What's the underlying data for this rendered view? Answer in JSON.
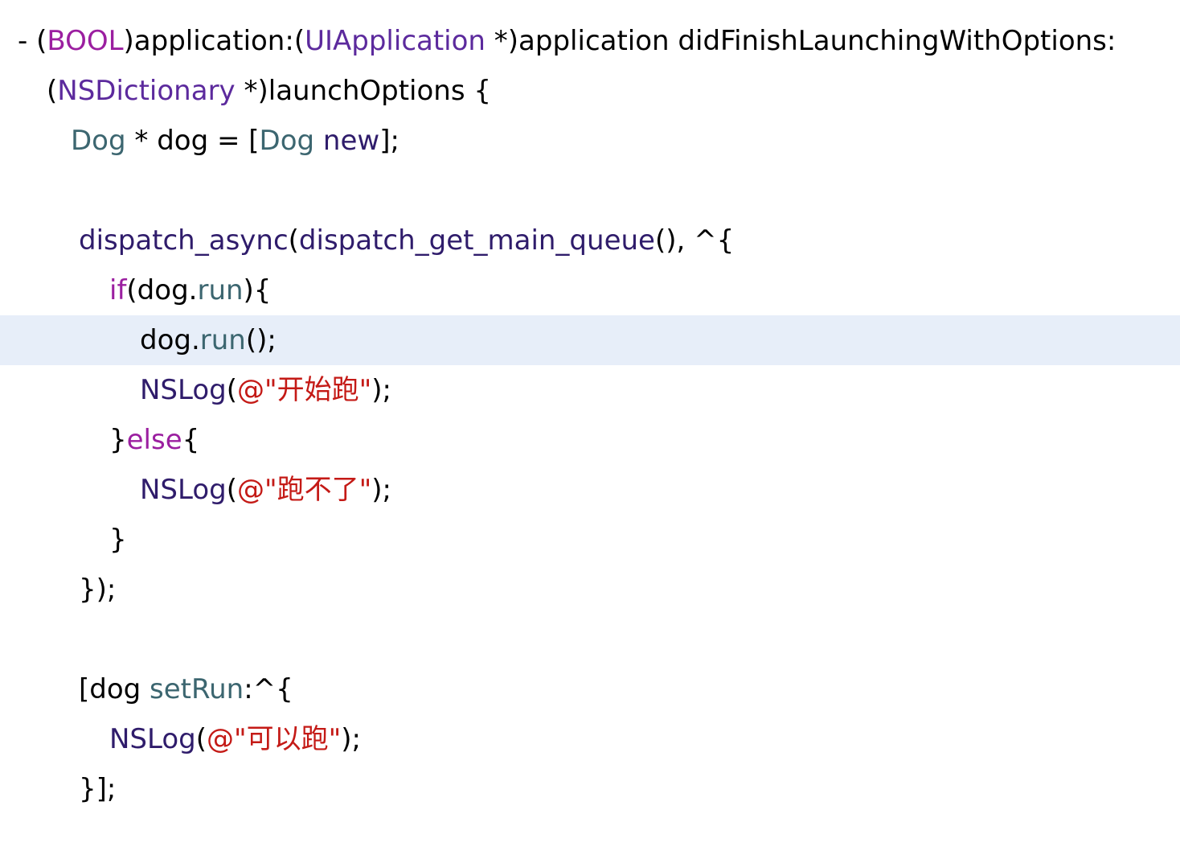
{
  "editor": {
    "language": "objective-c",
    "current_line": 6,
    "colors": {
      "background": "#ffffff",
      "current_line_highlight": "#e7eef9",
      "plain": "#000000",
      "keyword": "#9b1fa0",
      "system_type": "#5c2a9d",
      "class_name": "#3c6670",
      "function": "#2f1c6b",
      "method": "#3c6670",
      "property": "#3c6670",
      "string": "#c41a16"
    },
    "lines": [
      {
        "indent": 22,
        "tokens": [
          {
            "t": "- (",
            "k": "plain"
          },
          {
            "t": "BOOL",
            "k": "kw"
          },
          {
            "t": ")application:(",
            "k": "plain"
          },
          {
            "t": "UIApplication",
            "k": "sys"
          },
          {
            "t": " *)application didFinishLaunchingWithOptions:",
            "k": "plain"
          }
        ]
      },
      {
        "indent": 58,
        "tokens": [
          {
            "t": "(",
            "k": "plain"
          },
          {
            "t": "NSDictionary",
            "k": "sys"
          },
          {
            "t": " *)launchOptions {",
            "k": "plain"
          }
        ]
      },
      {
        "indent": 88,
        "tokens": [
          {
            "t": "Dog",
            "k": "class"
          },
          {
            "t": " * dog = [",
            "k": "plain"
          },
          {
            "t": "Dog",
            "k": "class"
          },
          {
            "t": " ",
            "k": "plain"
          },
          {
            "t": "new",
            "k": "func"
          },
          {
            "t": "];",
            "k": "plain"
          }
        ]
      },
      {
        "indent": 88,
        "tokens": []
      },
      {
        "indent": 98,
        "tokens": [
          {
            "t": "dispatch_async",
            "k": "func"
          },
          {
            "t": "(",
            "k": "plain"
          },
          {
            "t": "dispatch_get_main_queue",
            "k": "func"
          },
          {
            "t": "(), ^{",
            "k": "plain"
          }
        ]
      },
      {
        "indent": 136,
        "tokens": [
          {
            "t": "if",
            "k": "kw"
          },
          {
            "t": "(dog.",
            "k": "plain"
          },
          {
            "t": "run",
            "k": "prop"
          },
          {
            "t": "){",
            "k": "plain"
          }
        ]
      },
      {
        "indent": 174,
        "tokens": [
          {
            "t": "dog.",
            "k": "plain"
          },
          {
            "t": "run",
            "k": "prop"
          },
          {
            "t": "();",
            "k": "plain"
          }
        ]
      },
      {
        "indent": 174,
        "tokens": [
          {
            "t": "NSLog",
            "k": "func"
          },
          {
            "t": "(",
            "k": "plain"
          },
          {
            "t": "@\"开始跑\"",
            "k": "string"
          },
          {
            "t": ");",
            "k": "plain"
          }
        ]
      },
      {
        "indent": 136,
        "tokens": [
          {
            "t": "}",
            "k": "plain"
          },
          {
            "t": "else",
            "k": "kw"
          },
          {
            "t": "{",
            "k": "plain"
          }
        ]
      },
      {
        "indent": 174,
        "tokens": [
          {
            "t": "NSLog",
            "k": "func"
          },
          {
            "t": "(",
            "k": "plain"
          },
          {
            "t": "@\"跑不了\"",
            "k": "string"
          },
          {
            "t": ");",
            "k": "plain"
          }
        ]
      },
      {
        "indent": 136,
        "tokens": [
          {
            "t": "}",
            "k": "plain"
          }
        ]
      },
      {
        "indent": 98,
        "tokens": [
          {
            "t": "});",
            "k": "plain"
          }
        ]
      },
      {
        "indent": 98,
        "tokens": []
      },
      {
        "indent": 98,
        "tokens": [
          {
            "t": "[dog ",
            "k": "plain"
          },
          {
            "t": "setRun",
            "k": "method"
          },
          {
            "t": ":^{",
            "k": "plain"
          }
        ]
      },
      {
        "indent": 136,
        "tokens": [
          {
            "t": "NSLog",
            "k": "func"
          },
          {
            "t": "(",
            "k": "plain"
          },
          {
            "t": "@\"可以跑\"",
            "k": "string"
          },
          {
            "t": ");",
            "k": "plain"
          }
        ]
      },
      {
        "indent": 98,
        "tokens": [
          {
            "t": "}];",
            "k": "plain"
          }
        ]
      }
    ]
  }
}
